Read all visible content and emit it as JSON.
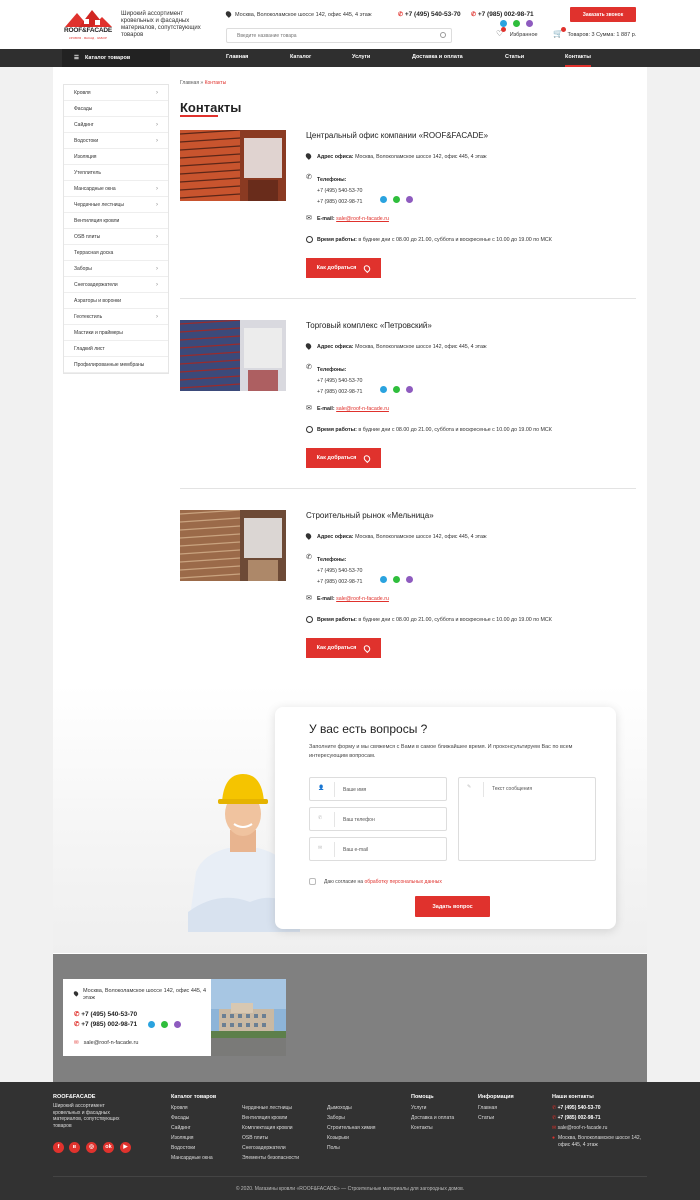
{
  "header": {
    "logo_text": "ROOF&FACADE",
    "logo_sub": "КРОВЛЯ · ФАСАД · ЗАБОР",
    "tagline": "Широкий ассортимент кровельных и фасадных материалов, сопутствующих товаров",
    "address": "Москва, Волоколамское шоссе 142, офис 445, 4 этаж",
    "phone1": "+7 (495) 540-53-70",
    "phone2": "+7 (985) 002-98-71",
    "callback_label": "Заказать звонок",
    "search_placeholder": "Введите название товара",
    "favorites_label": "Избранное",
    "cart_label": "Товаров: 3 Сумма: 1 887 р."
  },
  "nav": {
    "catalog_label": "Каталог товаров",
    "items": [
      "Главная",
      "Каталог",
      "Услуги",
      "Доставка и оплата",
      "Статьи",
      "Контакты"
    ]
  },
  "sidebar": {
    "items": [
      {
        "label": "Кровля",
        "chev": "›"
      },
      {
        "label": "Фасады",
        "chev": ""
      },
      {
        "label": "Сайдинг",
        "chev": "›"
      },
      {
        "label": "Водостоки",
        "chev": "›"
      },
      {
        "label": "Изоляция",
        "chev": ""
      },
      {
        "label": "Утеплитель",
        "chev": ""
      },
      {
        "label": "Мансардные окна",
        "chev": "›"
      },
      {
        "label": "Чердачные лестницы",
        "chev": "›"
      },
      {
        "label": "Вентиляция кровли",
        "chev": ""
      },
      {
        "label": "OSB плиты",
        "chev": "›"
      },
      {
        "label": "Террасная доска",
        "chev": ""
      },
      {
        "label": "Заборы",
        "chev": "›"
      },
      {
        "label": "Снегозадержатели",
        "chev": "›"
      },
      {
        "label": "Аэраторы и воронки",
        "chev": ""
      },
      {
        "label": "Геотекстиль",
        "chev": "›"
      },
      {
        "label": "Мастики и праймеры",
        "chev": ""
      },
      {
        "label": "Гладкий лист",
        "chev": ""
      },
      {
        "label": "Профилированные мембраны",
        "chev": ""
      }
    ]
  },
  "breadcrumb": {
    "home": "Главная",
    "sep": "»",
    "current": "Контакты"
  },
  "page_title": "Контакты",
  "labels": {
    "address": "Адрес офиса:",
    "phones": "Телефоны:",
    "email": "E-mail:",
    "hours": "Время работы:",
    "how_to_get": "Как добраться"
  },
  "offices": [
    {
      "title": "Центральный офис компании «ROOF&FACADE»",
      "address": "Москва, Волоколамское шоссе 142, офис 445, 4 этаж",
      "phone1": "+7 (495) 540-53-70",
      "phone2": "+7 (985) 002-98-71",
      "email": "sale@roof-n-facade.ru",
      "hours": "в будние дни с 08.00 до 21.00, суббота и воскресенье с 10.00 до 19.00 по МСК"
    },
    {
      "title": "Торговый комплекс «Петровский»",
      "address": "Москва, Волоколамское шоссе 142, офис 445, 4 этаж",
      "phone1": "+7 (495) 540-53-70",
      "phone2": "+7 (985) 002-98-71",
      "email": "sale@roof-n-facade.ru",
      "hours": "в будние дни с 08.00 до 21.00, суббота и воскресенье с 10.00 до 19.00 по МСК"
    },
    {
      "title": "Строительный рынок «Мельница»",
      "address": "Москва, Волоколамское шоссе 142, офис 445, 4 этаж",
      "phone1": "+7 (495) 540-53-70",
      "phone2": "+7 (985) 002-98-71",
      "email": "sale@roof-n-facade.ru",
      "hours": "в будние дни с 08.00 до 21.00, суббота и воскресенье с 10.00 до 19.00 по МСК"
    }
  ],
  "question_form": {
    "title": "У вас есть вопросы ?",
    "subtitle": "Заполните форму и мы свяжемся с Вами в самое ближайшее время. И проконсультируем Вас по всем интересующим вопросам.",
    "name_placeholder": "Ваше имя",
    "phone_placeholder": "Ваш телефон",
    "email_placeholder": "Ваш e-mail",
    "message_placeholder": "Текст сообщения",
    "consent_prefix": "Даю согласие на",
    "consent_link": "обработку персональных данных",
    "submit_label": "Задать вопрос"
  },
  "footer_contact": {
    "address": "Москва, Волоколамское шоссе 142, офис 445, 4 этаж",
    "phone1": "+7 (495) 540-53-70",
    "phone2": "+7 (985) 002-98-71",
    "email": "sale@roof-n-facade.ru"
  },
  "footer": {
    "brand": "ROOF&FACADE",
    "brand_desc": "Широкий ассортимент кровельных и фасадных материалов, сопутствующих товаров",
    "catalog_title": "Каталог товаров",
    "catalog_col1": [
      "Кровля",
      "Фасады",
      "Сайдинг",
      "Изоляция",
      "Водостоки",
      "Мансардные окна"
    ],
    "catalog_col2": [
      "Чердачные лестницы",
      "Вентиляция кровли",
      "Комплектация кровли",
      "OSB плиты",
      "Снегозадержатели",
      "Элементы безопасности"
    ],
    "catalog_col3": [
      "Дымоходы",
      "Заборы",
      "Строительная химия",
      "Козырьки",
      "Полы"
    ],
    "help_title": "Помощь",
    "help_items": [
      "Услуги",
      "Доставка и оплата",
      "Контакты"
    ],
    "info_title": "Информация",
    "info_items": [
      "Главная",
      "Статьи"
    ],
    "contacts_title": "Наши контакты",
    "phone1": "+7 (495) 540-53-70",
    "phone2": "+7 (985) 002-98-71",
    "email": "sale@roof-n-facade.ru",
    "address": "Москва, Волоколамское шоссе 142, офис 445, 4 этаж",
    "social": [
      "f",
      "vk",
      "ig",
      "ok",
      "yt"
    ],
    "copyright": "© 2020. Магазины кровли «ROOF&FACADE» — Строительные материалы для загородных домов."
  },
  "colors": {
    "accent": "#e0322d",
    "dark": "#2f2f2f",
    "footer": "#323232",
    "telegram": "#2aa3df",
    "whatsapp": "#2fbe3c",
    "viber": "#8e5bbf"
  }
}
